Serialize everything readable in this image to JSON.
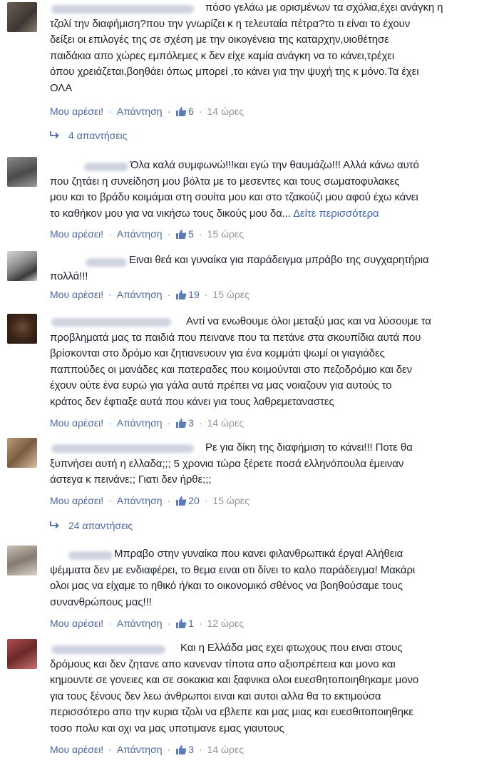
{
  "ui": {
    "like_label": "Μου αρέσει!",
    "reply_label": "Απάντηση",
    "separator": "·",
    "see_more": "Δείτε περισσότερα"
  },
  "comments": [
    {
      "lines": [
        "πόσο γελάω με ορισμένων τα σχόλια,έχει ανάγκη η",
        "τζολί την διαφήμιση?που την γνωρίζει κ η τελευταία πέτρα?το τι είναι το έχουν",
        "δείξει οι επιλογές της σε σχέση με την οικογένεια της καταρχην,υιοθέτησε",
        "παιδάκια απο χώρες εμπόλεμες κ δεν είχε καμία ανάγκη να το κάνει,τρέχει",
        "όπου χρειάζεται,βοηθάει όπως μπορεί ,το κάνει για την ψυχή της κ μόνο.Τα έχει",
        "ΟΛΑ"
      ],
      "likes": "6",
      "time": "14 ώρες",
      "replies": "4 απαντήσεις"
    },
    {
      "lines": [
        "Όλα καλά συμφωνώ!!!και εγώ την θαυμάζω!!! Αλλά κάνω αυτό",
        "που ζητάει η συνείδηση μου βόλτα με το μεσεντες και τους σωματοφυλακες",
        "μου και το βράδυ κοιμάμαι στη σουίτα μου και στο τζακούζι μου αφού έχω κάνει",
        "το καθήκον μου για να νικήσω τους δικούς μου δα..."
      ],
      "likes": "5",
      "time": "15 ώρες"
    },
    {
      "lines": [
        "Ειναι θεά και γυναίκα για παράδειγμα μπράβο της συγχαρητήρια",
        "πολλά!!!"
      ],
      "likes": "19",
      "time": "15 ώρες"
    },
    {
      "lines": [
        "Αντί να ενωθουμε όλοι μεταξύ μας και να λύσουμε τα",
        "προβληματά μας τα παιδιά που πεινανε που τα πετάνε στα σκουπίδια αυτά που",
        "βρίσκονται στο δρόμο και ζητιανευουν για ένα κομμάτι ψωμί οι γιαγιάδες",
        "παππούδες οι μανάδες και πατεραδες που κοιμούνται στο πεζοδρόμιο και δεν",
        "έχουν ούτε ένα ευρώ για γάλα αυτά πρέπει να μας νοιαζουν για αυτούς το",
        "κράτος δεν έφτιαξε αυτά που κάνει για τους λαθρεμεταναστες"
      ],
      "likes": "3",
      "time": "14 ώρες"
    },
    {
      "lines": [
        "Ρε για δίκη της διαφήμιση το κάνει!!! Ποτε θα",
        "ξυπνήσει αυτή η ελλαδα;;; 5 χρονια τώρα ξέρετε ποσά ελληνόπουλα έμειναν",
        "άστεγα κ πεινάνε;; Γιατι δεν ήρθε;;;"
      ],
      "likes": "20",
      "time": "15 ώρες",
      "replies": "24 απαντήσεις"
    },
    {
      "lines": [
        "Μπραβο στην γυναίκα που κανει φιλανθρωπικά έργα! Αλήθεια",
        "ψέμματα δεν με ενδιαφέρει, το θεμα ειναι οτι δίνει το καλο παράδειγμα! Μακάρι",
        "ολοι μας να είχαμε το ηθικό ή/και το οικονομικό σθένος να βοηθούσαμε τους",
        "συνανθρώπους μας!!!"
      ],
      "likes": "1",
      "time": "12 ώρες"
    },
    {
      "lines": [
        "Και η Ελλάδα μας εχει φτωχους που ειναι στους",
        "δρόμους και δεν ζητανε απο κανεναν τίποτα απο αξιοπρέπεια και μονο και",
        "κημουντε σε γονειες και σε σοκακια και ξαφνικα ολοι ευεσθητοποιηθηκαμε μονο",
        "για τους ξένους δεν λεω άνθρωποι ειναι και αυτοι αλλα θα το εκτιμούσα",
        "περισσότερο απο την κυρια τζολι να εβλεπε και μας μιας και ευεσθιτοποιηθηκε",
        "τοσο πολυ και οχι να μας υποτιμανε εμας γιαυτους"
      ],
      "likes": "3",
      "time": "14 ώρες"
    }
  ]
}
